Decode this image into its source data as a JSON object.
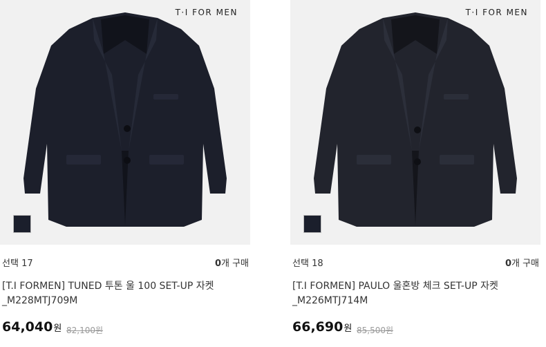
{
  "products": [
    {
      "brand_logo": "T·I FOR MEN",
      "select_label": "선택",
      "select_count": "17",
      "buy_count": "0",
      "buy_label": "개 구매",
      "name_line1": "[T.I FORMEN] TUNED 투톤 울 100 SET-UP 자켓",
      "name_line2": "_M228MTJ709M",
      "price": "64,040",
      "currency": "원",
      "original_price": "82,100원",
      "swatch_color": "#1b1f2c"
    },
    {
      "brand_logo": "T·I FOR MEN",
      "select_label": "선택",
      "select_count": "18",
      "buy_count": "0",
      "buy_label": "개 구매",
      "name_line1": "[T.I FORMEN] PAULO 울혼방 체크 SET-UP 자켓",
      "name_line2": "_M226MTJ714M",
      "price": "66,690",
      "currency": "원",
      "original_price": "85,500원",
      "swatch_color": "#1b1f2c"
    }
  ]
}
